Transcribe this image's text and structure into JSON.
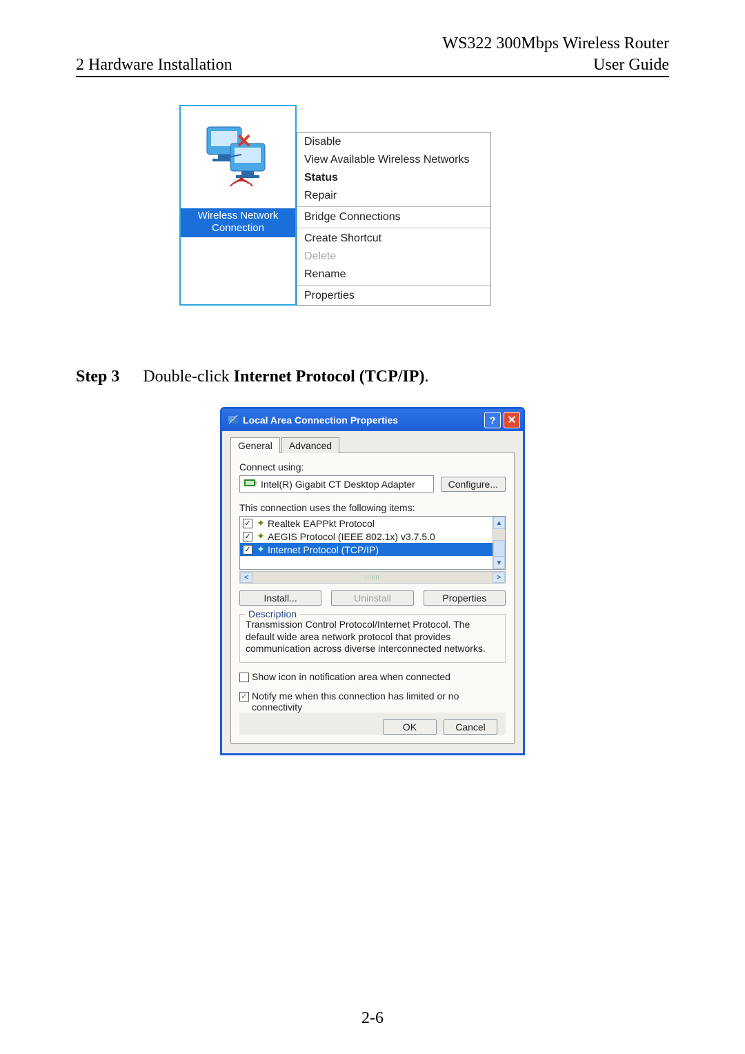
{
  "header": {
    "product": "WS322 300Mbps Wireless Router",
    "section": "2 Hardware Installation",
    "doc": "User Guide"
  },
  "context_menu": {
    "icon_caption_line1": "Wireless Network",
    "icon_caption_line2": "Connection",
    "items": {
      "disable": "Disable",
      "view": "View Available Wireless Networks",
      "status": "Status",
      "repair": "Repair",
      "bridge": "Bridge Connections",
      "shortcut": "Create Shortcut",
      "delete": "Delete",
      "rename": "Rename",
      "properties": "Properties"
    }
  },
  "step3": {
    "label": "Step 3",
    "text_before": "Double-click ",
    "bold": "Internet Protocol (TCP/IP)",
    "text_after": "."
  },
  "dialog": {
    "title": "Local Area Connection Properties",
    "tabs": {
      "general": "General",
      "advanced": "Advanced"
    },
    "connect_using_label": "Connect using:",
    "adapter_name": "Intel(R) Gigabit CT Desktop Adapter",
    "configure_btn": "Configure...",
    "items_label": "This connection uses the following items:",
    "list": {
      "realtek": "Realtek EAPPkt Protocol",
      "aegis": "AEGIS Protocol (IEEE 802.1x) v3.7.5.0",
      "tcpip": "Internet Protocol (TCP/IP)"
    },
    "buttons": {
      "install": "Install...",
      "uninstall": "Uninstall",
      "properties": "Properties"
    },
    "description_label": "Description",
    "description_text": "Transmission Control Protocol/Internet Protocol. The default wide area network protocol that provides communication across diverse interconnected networks.",
    "show_icon_label": "Show icon in notification area when connected",
    "notify_label": "Notify me when this connection has limited or no connectivity",
    "ok": "OK",
    "cancel": "Cancel"
  },
  "page_number": "2-6"
}
